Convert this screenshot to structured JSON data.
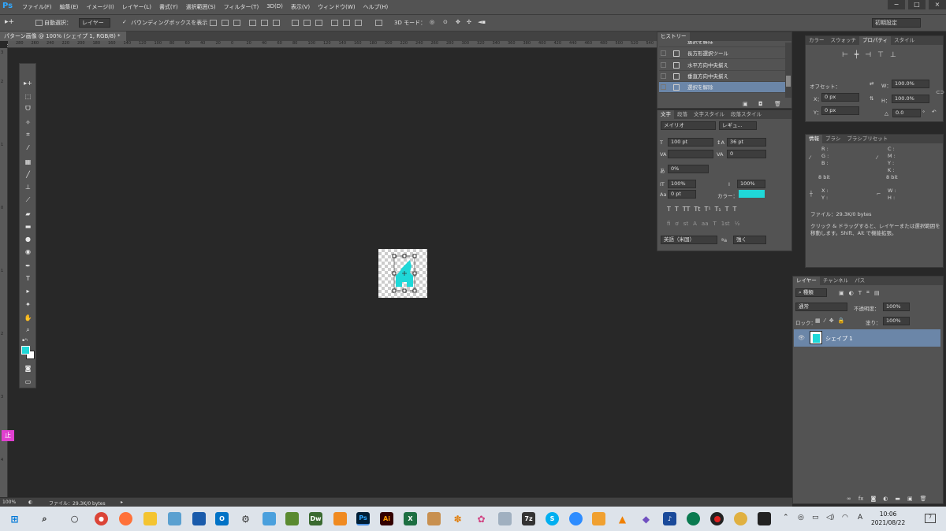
{
  "app": {
    "logo": "Ps"
  },
  "menu": [
    "ファイル(F)",
    "編集(E)",
    "イメージ(I)",
    "レイヤー(L)",
    "書式(Y)",
    "選択範囲(S)",
    "フィルター(T)",
    "3D(D)",
    "表示(V)",
    "ウィンドウ(W)",
    "ヘルプ(H)"
  ],
  "window_controls": [
    "−",
    "□",
    "×"
  ],
  "options": {
    "auto_select_label": "自動選択：",
    "auto_select_value": "レイヤー",
    "bounding_box_label": "バウンディングボックスを表示",
    "mode_3d_label": "3D モード：",
    "workspace": "初期設定"
  },
  "document": {
    "tab_title": "パターン画像 @ 100% (シェイプ 1, RGB/8) *",
    "close": "×"
  },
  "ruler_top": [
    "280",
    "260",
    "240",
    "220",
    "200",
    "180",
    "160",
    "140",
    "120",
    "100",
    "80",
    "60",
    "40",
    "20",
    "0",
    "20",
    "40",
    "60",
    "80",
    "100",
    "120",
    "140",
    "160",
    "180",
    "200",
    "220",
    "240",
    "260",
    "280",
    "300",
    "320",
    "340",
    "360",
    "380",
    "400",
    "420",
    "440",
    "460",
    "480",
    "500",
    "520",
    "540",
    "560",
    "580",
    "600",
    "620",
    "640",
    "660"
  ],
  "status": {
    "zoom": "100%",
    "file": "ファイル：29.3K/0 bytes"
  },
  "history": {
    "tabs": [
      "ヒストリー"
    ],
    "rows": [
      "選択を解除",
      "長方形選択ツール",
      "水平方向中央揃え",
      "垂直方向中央揃え",
      "選択を解除"
    ]
  },
  "character": {
    "tabs": [
      "文字",
      "段落",
      "文字スタイル",
      "段落スタイル"
    ],
    "font": "メイリオ",
    "style": "レギュ...",
    "size": "100 pt",
    "leading": "36 pt",
    "kerning": "",
    "tracking": "0",
    "scale_pct": "0%",
    "v_scale": "100%",
    "h_scale": "100%",
    "baseline": "0 pt",
    "color_label": "カラー：",
    "color": "#1fd8d8",
    "styles": [
      "T",
      "T",
      "TT",
      "Tt",
      "T¹",
      "T₁",
      "T",
      "T"
    ],
    "ot": [
      "fi",
      "ơ",
      "st",
      "A",
      "aa",
      "T",
      "1st",
      "½"
    ],
    "language": "英語（米国）",
    "aa_label": "ªa",
    "aa": "強く"
  },
  "properties": {
    "tabs": [
      "カラー",
      "スウォッチ",
      "プロパティ",
      "スタイル"
    ],
    "offset_label": "オフセット：",
    "x_label": "X：",
    "x": "0 px",
    "y_label": "Y：",
    "y": "0 px",
    "w_label": "W：",
    "w": "100.0%",
    "h_label": "H：",
    "h": "100.0%",
    "angle": "0.0",
    "deg": "°"
  },
  "info": {
    "tabs": [
      "情報",
      "ブラシ",
      "ブラシプリセット"
    ],
    "rgb": [
      "R :",
      "G :",
      "B :"
    ],
    "cmyk": [
      "C :",
      "M :",
      "Y :",
      "K :"
    ],
    "bit1": "8 bit",
    "bit2": "8 bit",
    "xy": [
      "X :",
      "Y :"
    ],
    "wh": [
      "W :",
      "H :"
    ],
    "file": "ファイル：29.3K/0 bytes",
    "hint": "クリック & ドラッグすると、レイヤーまたは選択範囲を移動します。Shift、Alt で機能拡張。"
  },
  "layers": {
    "tabs": [
      "レイヤー",
      "チャンネル",
      "パス"
    ],
    "kind": "種類",
    "blend": "通常",
    "opacity_label": "不透明度：",
    "opacity": "100%",
    "lock_label": "ロック：",
    "fill_label": "塗り：",
    "fill": "100%",
    "layer_name": "シェイプ 1"
  },
  "taskbar": {
    "time": "10:06",
    "date": "2021/08/22",
    "ime": "A",
    "notif": "7"
  },
  "colors": {
    "accent": "#1fd8d8",
    "selection": "#6b86a8",
    "ui": "#535353",
    "bg": "#282828"
  }
}
